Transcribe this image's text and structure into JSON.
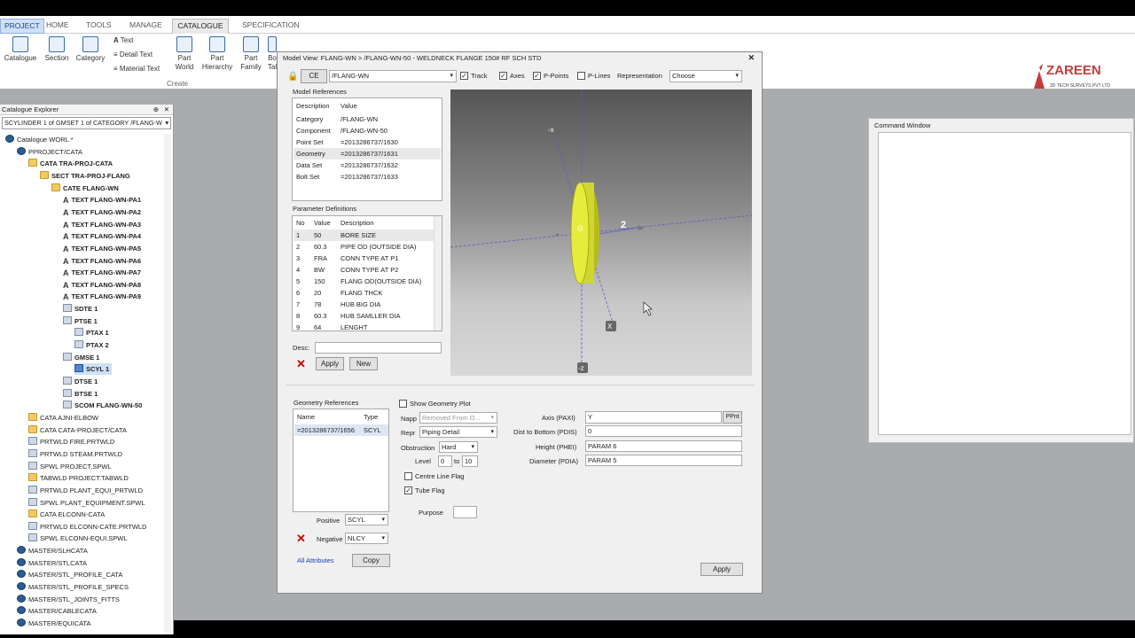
{
  "tabs": [
    "PROJECT",
    "HOME",
    "TOOLS",
    "MANAGE",
    "CATALOGUE",
    "SPECIFICATION"
  ],
  "ribbon": {
    "buttons": [
      "Catalogue",
      "Section",
      "Category",
      "Part World",
      "Part Hierarchy",
      "Part Family",
      "Bo Tal"
    ],
    "small": [
      "Text",
      "Detail Text",
      "Material Text"
    ],
    "group": "Create"
  },
  "explorer": {
    "title": "Catalogue Explorer",
    "path": "SCYLINDER 1 of GMSET 1 of CATEGORY /FLANG-W",
    "tree": [
      {
        "t": "Catalogue WORL *",
        "l": 0,
        "i": "db",
        "b": false
      },
      {
        "t": "PPROJECT/CATA",
        "l": 1,
        "i": "db",
        "b": false
      },
      {
        "t": "CATA TRA-PROJ-CATA",
        "l": 2,
        "i": "fd",
        "b": true
      },
      {
        "t": "SECT TRA-PROJ-FLANG",
        "l": 3,
        "i": "fd",
        "b": true
      },
      {
        "t": "CATE FLANG-WN",
        "l": 4,
        "i": "fd",
        "b": true
      },
      {
        "t": "TEXT FLANG-WN-PA1",
        "l": 5,
        "i": "tx",
        "b": true
      },
      {
        "t": "TEXT FLANG-WN-PA2",
        "l": 5,
        "i": "tx",
        "b": true
      },
      {
        "t": "TEXT FLANG-WN-PA3",
        "l": 5,
        "i": "tx",
        "b": true
      },
      {
        "t": "TEXT FLANG-WN-PA4",
        "l": 5,
        "i": "tx",
        "b": true
      },
      {
        "t": "TEXT FLANG-WN-PA5",
        "l": 5,
        "i": "tx",
        "b": true
      },
      {
        "t": "TEXT FLANG-WN-PA6",
        "l": 5,
        "i": "tx",
        "b": true
      },
      {
        "t": "TEXT FLANG-WN-PA7",
        "l": 5,
        "i": "tx",
        "b": true
      },
      {
        "t": "TEXT FLANG-WN-PA8",
        "l": 5,
        "i": "tx",
        "b": true
      },
      {
        "t": "TEXT FLANG-WN-PA9",
        "l": 5,
        "i": "tx",
        "b": true
      },
      {
        "t": "SDTE 1",
        "l": 5,
        "i": "it",
        "b": true
      },
      {
        "t": "PTSE 1",
        "l": 5,
        "i": "it",
        "b": true
      },
      {
        "t": "PTAX 1",
        "l": 6,
        "i": "it",
        "b": true
      },
      {
        "t": "PTAX 2",
        "l": 6,
        "i": "it",
        "b": true
      },
      {
        "t": "GMSE 1",
        "l": 5,
        "i": "it",
        "b": true
      },
      {
        "t": "SCYL 1",
        "l": 6,
        "i": "sel",
        "b": true
      },
      {
        "t": "DTSE 1",
        "l": 5,
        "i": "it",
        "b": true
      },
      {
        "t": "BTSE 1",
        "l": 5,
        "i": "it",
        "b": true
      },
      {
        "t": "SCOM FLANG-WN-50",
        "l": 5,
        "i": "it",
        "b": true
      },
      {
        "t": "CATA AJNI-ELBOW",
        "l": 2,
        "i": "fd",
        "b": false
      },
      {
        "t": "CATA CATA-PROJECT/CATA",
        "l": 2,
        "i": "fd",
        "b": false
      },
      {
        "t": "PRTWLD FIRE.PRTWLD",
        "l": 2,
        "i": "it",
        "b": false
      },
      {
        "t": "PRTWLD STEAM.PRTWLD",
        "l": 2,
        "i": "it",
        "b": false
      },
      {
        "t": "SPWL PROJECT.SPWL",
        "l": 2,
        "i": "it",
        "b": false
      },
      {
        "t": "TABWLD PROJECT.TABWLD",
        "l": 2,
        "i": "fd",
        "b": false
      },
      {
        "t": "PRTWLD PLANT_EQUI_PRTWLD",
        "l": 2,
        "i": "it",
        "b": false
      },
      {
        "t": "SPWL PLANT_EQUIPMENT.SPWL",
        "l": 2,
        "i": "it",
        "b": false
      },
      {
        "t": "CATA ELCONN-CATA",
        "l": 2,
        "i": "fd",
        "b": false
      },
      {
        "t": "PRTWLD ELCONN-CATE.PRTWLD",
        "l": 2,
        "i": "it",
        "b": false
      },
      {
        "t": "SPWL ELCONN-EQUI.SPWL",
        "l": 2,
        "i": "it",
        "b": false
      },
      {
        "t": "MASTER/SLHCATA",
        "l": 1,
        "i": "db",
        "b": false
      },
      {
        "t": "MASTER/STLCATA",
        "l": 1,
        "i": "db",
        "b": false
      },
      {
        "t": "MASTER/STL_PROFILE_CATA",
        "l": 1,
        "i": "db",
        "b": false
      },
      {
        "t": "MASTER/STL_PROFILE_SPECS",
        "l": 1,
        "i": "db",
        "b": false
      },
      {
        "t": "MASTER/STL_JOINTS_FITTS",
        "l": 1,
        "i": "db",
        "b": false
      },
      {
        "t": "MASTER/CABLECATA",
        "l": 1,
        "i": "db",
        "b": false
      },
      {
        "t": "MASTER/EQUICATA",
        "l": 1,
        "i": "db",
        "b": false
      }
    ]
  },
  "dialog": {
    "title": "Model View: FLANG-WN > /FLANG-WN-50 - WELDNECK FLANGE 150# RF SCH STD",
    "ce_label": "CE",
    "ce_value": "/FLANG-WN",
    "track": "Track",
    "axes": "Axes",
    "ppoints": "P-Points",
    "plines": "P-Lines",
    "representation_label": "Representation",
    "representation_value": "Choose",
    "model_refs": {
      "title": "Model References",
      "headers": [
        "Description",
        "Value"
      ],
      "rows": [
        [
          "Category",
          "/FLANG-WN"
        ],
        [
          "Component",
          "/FLANG-WN-50"
        ],
        [
          "Point Set",
          "=2013286737/1630"
        ],
        [
          "Geometry",
          "=2013286737/1631"
        ],
        [
          "Data Set",
          "=2013286737/1632"
        ],
        [
          "Bolt Set",
          "=2013286737/1633"
        ]
      ]
    },
    "params": {
      "title": "Parameter Definitions",
      "headers": [
        "No",
        "Value",
        "Description"
      ],
      "rows": [
        [
          "1",
          "50",
          "BORE SIZE"
        ],
        [
          "2",
          "60.3",
          "PIPE OD (OUTSIDE DIA)"
        ],
        [
          "3",
          "FRA",
          "CONN TYPE AT P1"
        ],
        [
          "4",
          "BW",
          "CONN TYPE AT P2"
        ],
        [
          "5",
          "150",
          "FLANG OD(OUTSIDE DIA)"
        ],
        [
          "6",
          "20",
          "FLANG THCK"
        ],
        [
          "7",
          "78",
          "HUB BIG DIA"
        ],
        [
          "8",
          "60.3",
          "HUB SAMLLER DIA"
        ],
        [
          "9",
          "64",
          "LENGHT"
        ]
      ]
    },
    "desc_label": "Desc:",
    "apply": "Apply",
    "new": "New",
    "viewport_labels": {
      "neg_x": "-x",
      "neg_z": "-z",
      "axis2": "2",
      "x": "X"
    },
    "geom_refs": {
      "title": "Geometry References",
      "headers": [
        "Name",
        "Type"
      ],
      "rows": [
        [
          "=2013286737/1656",
          "SCYL"
        ]
      ]
    },
    "show_geom": "Show Geometry Plot",
    "napp_label": "Napp",
    "napp_value": "Removed From O...",
    "repr_label": "Repr",
    "repr_value": "Piping Detail",
    "obstruction_label": "Obstruction",
    "obstruction_value": "Hard",
    "level_label": "Level",
    "level_from": "0",
    "level_to_label": "to",
    "level_to": "10",
    "centre_line": "Centre Line Flag",
    "tube_flag": "Tube Flag",
    "purpose_label": "Purpose",
    "axis_label": "Axis (PAXI)",
    "axis_value": "Y",
    "ppnt": "PPnt",
    "dist_label": "Dist to Bottom (PDIS)",
    "dist_value": "0",
    "height_label": "Height (PHEI)",
    "height_value": "PARAM 6",
    "diam_label": "Diameter (PDIA)",
    "diam_value": "PARAM 5",
    "positive_label": "Positive",
    "positive_value": "SCYL",
    "negative_label": "Negative",
    "negative_value": "NLCY",
    "all_attributes": "All Attributes",
    "copy": "Copy",
    "apply_bottom": "Apply"
  },
  "command_window": {
    "title": "Command Window"
  },
  "logo": {
    "text": "ZAREEN",
    "sub": "3D TECH SURVEYS PVT LTD"
  }
}
